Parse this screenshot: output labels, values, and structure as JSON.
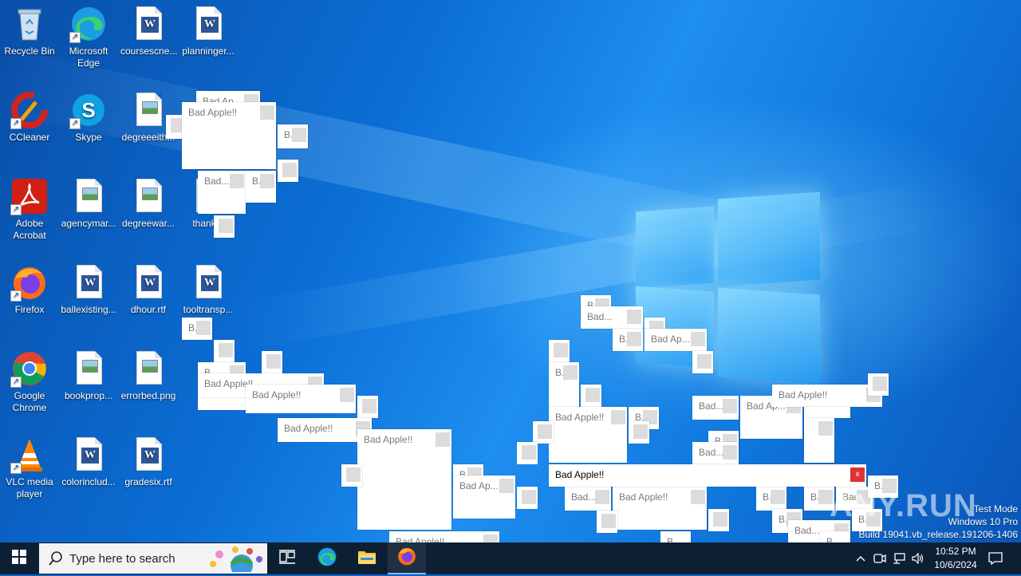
{
  "desktop": {
    "icons": [
      {
        "label": "Recycle Bin",
        "icon": "recycle-bin-icon"
      },
      {
        "label": "Microsoft Edge",
        "icon": "edge-icon"
      },
      {
        "label": "coursescne...",
        "icon": "word-doc-icon"
      },
      {
        "label": "planninger...",
        "icon": "word-doc-icon"
      },
      {
        "label": "CCleaner",
        "icon": "ccleaner-icon"
      },
      {
        "label": "Skype",
        "icon": "skype-icon"
      },
      {
        "label": "degreeeith...",
        "icon": "image-file-icon"
      },
      {
        "label": "Adobe Acrobat",
        "icon": "acrobat-icon"
      },
      {
        "label": "agencymar...",
        "icon": "image-file-icon"
      },
      {
        "label": "degreewar...",
        "icon": "image-file-icon"
      },
      {
        "label": "thankm",
        "icon": "image-file-icon"
      },
      {
        "label": "Firefox",
        "icon": "firefox-icon"
      },
      {
        "label": "ballexisting...",
        "icon": "word-doc-icon"
      },
      {
        "label": "dhour.rtf",
        "icon": "word-doc-icon"
      },
      {
        "label": "tooltransp...",
        "icon": "word-doc-icon"
      },
      {
        "label": "Google Chrome",
        "icon": "chrome-icon"
      },
      {
        "label": "bookprop...",
        "icon": "image-file-icon"
      },
      {
        "label": "errorbed.png",
        "icon": "image-file-icon"
      },
      {
        "label": "VLC media player",
        "icon": "vlc-icon"
      },
      {
        "label": "colorinclud...",
        "icon": "word-doc-icon"
      },
      {
        "label": "gradesix.rtf",
        "icon": "word-doc-icon"
      }
    ]
  },
  "popups": {
    "full": "Bad Apple!!",
    "ap": "Bad Ap...",
    "d": "Bad...",
    "b": "B...",
    "bshort": "B.",
    "close_glyph": "x"
  },
  "watermark": {
    "brand": "ANY.RUN",
    "line1": "Test Mode",
    "line2": "Windows 10 Pro",
    "line3": "Build 19041.vb_release.191206-1406"
  },
  "taskbar": {
    "search_placeholder": "Type here to search",
    "time": "10:52 PM",
    "date": "10/6/2024",
    "pinned": [
      "start-icon",
      "task-view-icon",
      "edge-icon",
      "file-explorer-icon",
      "firefox-icon"
    ],
    "tray": [
      "chevron-up-icon",
      "meet-now-icon",
      "network-icon",
      "volume-icon",
      "notification-icon"
    ]
  },
  "colors": {
    "accent": "#0a63c9",
    "taskbar": "#0d1f33",
    "close_red": "#d33333"
  }
}
